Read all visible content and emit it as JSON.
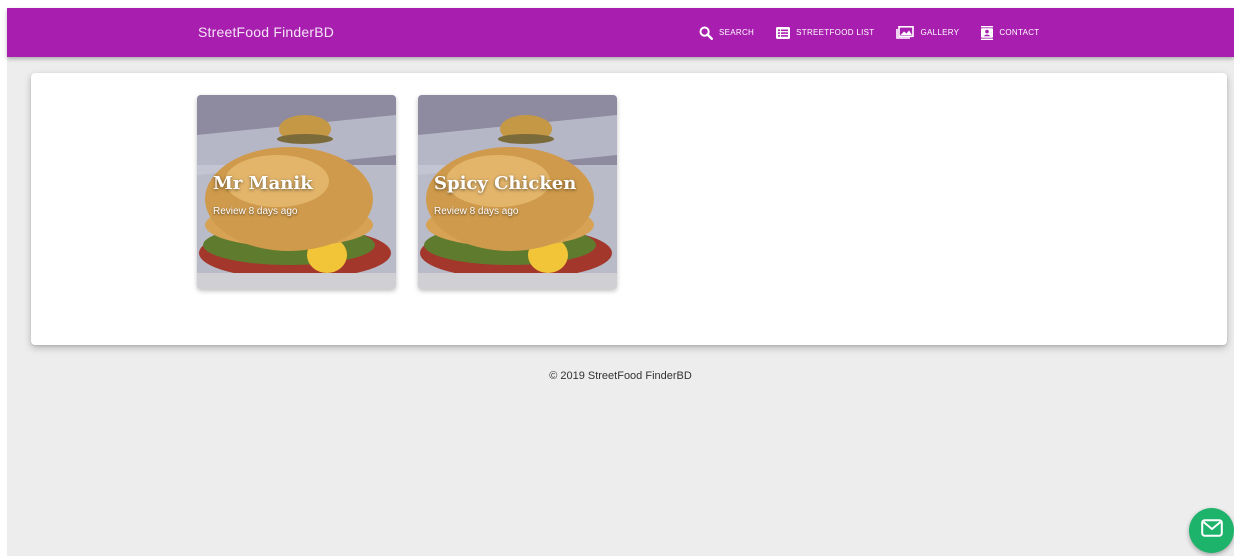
{
  "header": {
    "brand": "StreetFood FinderBD",
    "bg_color": "#a81fb0",
    "nav": [
      {
        "label": "SEARCH",
        "icon": "search-icon"
      },
      {
        "label": "STREETFOOD LIST",
        "icon": "list-icon"
      },
      {
        "label": "GALLERY",
        "icon": "gallery-icon"
      },
      {
        "label": "CONTACT",
        "icon": "contact-icon"
      }
    ]
  },
  "cards": [
    {
      "title": "Mr Manik",
      "subtitle": "Review 8 days ago",
      "image": "burger photo"
    },
    {
      "title": "Spicy Chicken",
      "subtitle": "Review 8 days ago",
      "image": "burger photo"
    }
  ],
  "footer": {
    "text": "© 2019 StreetFood FinderBD"
  },
  "fab": {
    "icon": "mail-icon",
    "color": "#1db36a"
  }
}
